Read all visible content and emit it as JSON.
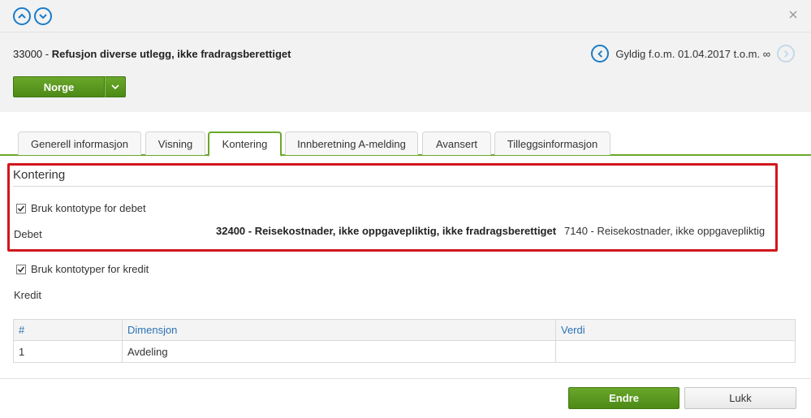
{
  "window": {
    "nav_up_icon": "chevron-up-icon",
    "nav_down_icon": "chevron-down-icon",
    "close_icon": "close-icon"
  },
  "header": {
    "code": "33000",
    "separator": " - ",
    "name": "Refusjon diverse utlegg, ikke fradragsberettiget",
    "validity": "Gyldig f.o.m. 01.04.2017 t.o.m. ∞",
    "country_button": "Norge"
  },
  "tabs": [
    {
      "label": "Generell informasjon",
      "active": false
    },
    {
      "label": "Visning",
      "active": false
    },
    {
      "label": "Kontering",
      "active": true
    },
    {
      "label": "Innberetning A-melding",
      "active": false
    },
    {
      "label": "Avansert",
      "active": false
    },
    {
      "label": "Tilleggsinformasjon",
      "active": false
    }
  ],
  "kontering": {
    "section_title": "Kontering",
    "debet_checkbox_label": "Bruk kontotype for debet",
    "debet_checked": true,
    "debet_label": "Debet",
    "debet_account": "32400 - Reisekostnader, ikke oppgavepliktig, ikke fradragsberettiget",
    "debet_type": "7140 - Reisekostnader, ikke oppgavepliktig",
    "kredit_checkbox_label": "Bruk kontotyper for kredit",
    "kredit_checked": true,
    "kredit_label": "Kredit"
  },
  "dimension_table": {
    "headers": [
      "#",
      "Dimensjon",
      "Verdi"
    ],
    "rows": [
      {
        "num": "1",
        "dimensjon": "Avdeling",
        "verdi": ""
      }
    ]
  },
  "footer": {
    "edit_button": "Endre",
    "close_button": "Lukk"
  },
  "colors": {
    "accent_green": "#5a9a20",
    "link_blue": "#1a7bc8",
    "highlight_red": "#d1161c"
  }
}
